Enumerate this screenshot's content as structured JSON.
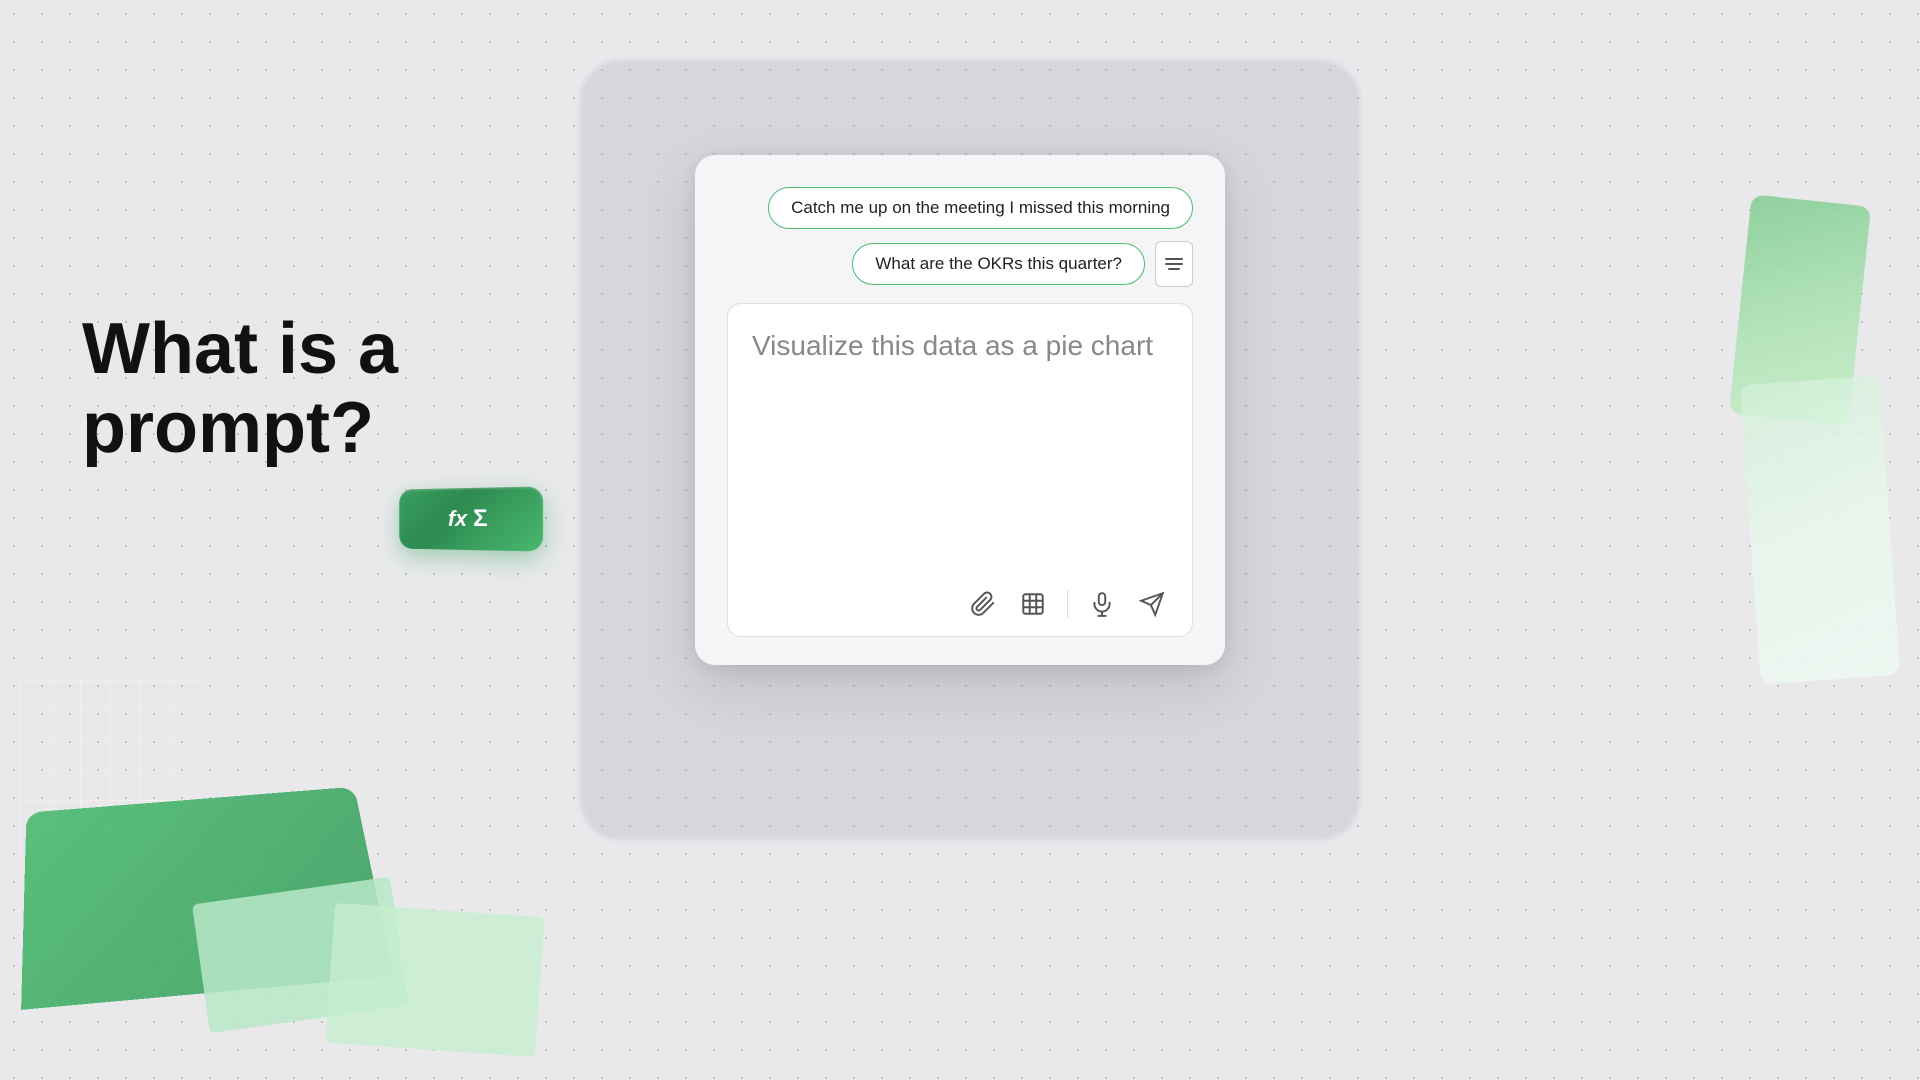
{
  "background": {
    "color": "#e8e8ea"
  },
  "heading": {
    "line1": "What is a prompt?"
  },
  "excel_button": {
    "fx_label": "fx",
    "sigma_label": "Σ"
  },
  "chat_card": {
    "chip1": "Catch me up on the meeting I missed this morning",
    "chip2": "What are the OKRs this quarter?",
    "input_placeholder": "Visualize this data as a pie chart",
    "icons": {
      "attach": "attach-icon",
      "table": "table-icon",
      "microphone": "microphone-icon",
      "send": "send-icon"
    }
  }
}
